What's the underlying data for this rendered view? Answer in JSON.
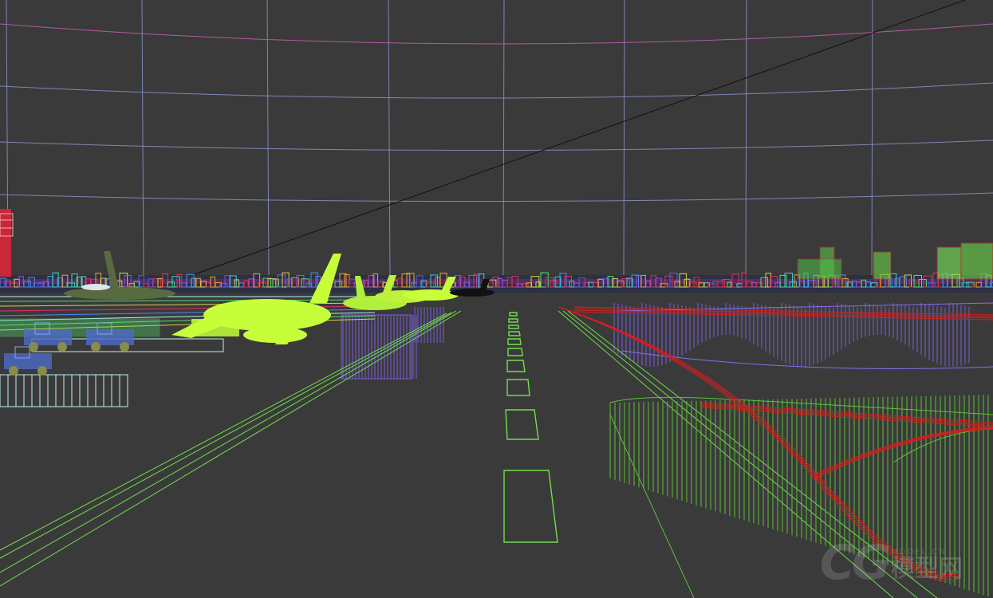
{
  "viewport": {
    "view_mode": "wireframe",
    "background_color": "#3a3a3a"
  },
  "colors": {
    "sky_grid_lines": "#7f86b5",
    "sky_grid_horizon": "#b55aa0",
    "runway_markings": "#6fe04a",
    "aircraft_fill": "#c6ff3a",
    "terminal_wire": "#7a5ce0",
    "taxiway_wire": "#d21f1f",
    "ground_wire": "#5fbf3a",
    "gse_wire": "#b9f2f2",
    "control_tower": "#c8283a"
  },
  "scene_objects": [
    "sky-dome-grid",
    "runway",
    "runway-centerline-markings",
    "aircraft",
    "terminal-buildings",
    "ground-vehicles",
    "control-tower",
    "city-skyline",
    "taxiway-wireframe"
  ],
  "watermark": {
    "logo": "CG",
    "small_text": "MODEL.CN",
    "big_text": "模型网"
  }
}
